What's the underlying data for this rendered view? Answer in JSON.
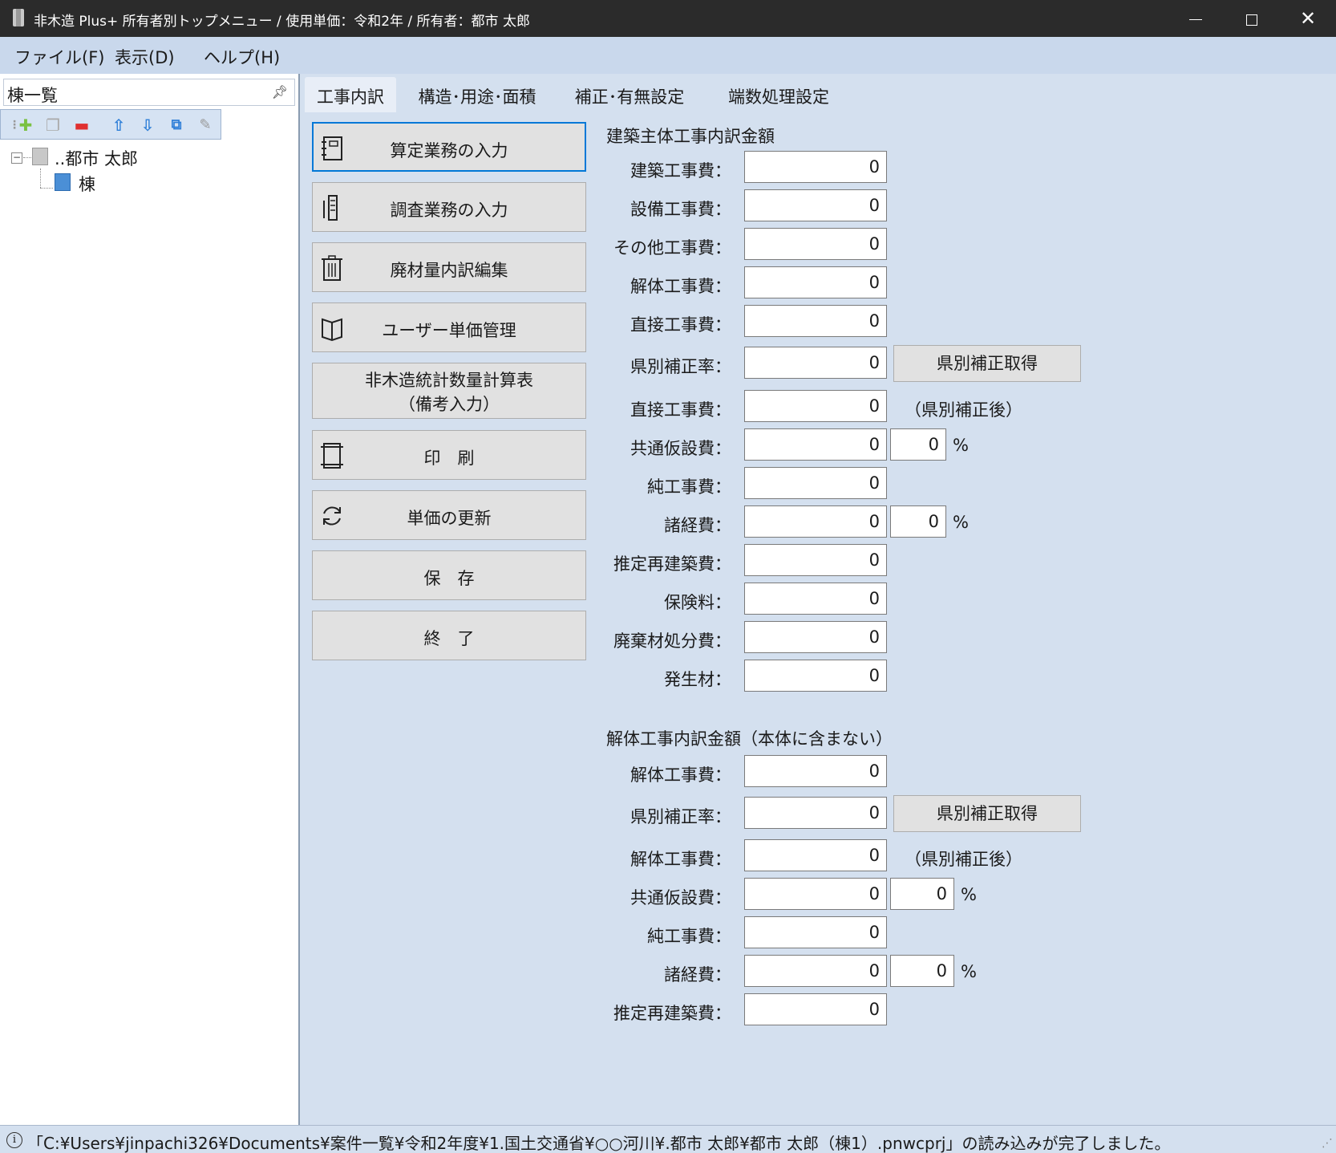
{
  "window": {
    "title": "非木造 Plus+ 所有者別トップメニュー / 使用単価：令和2年 / 所有者：都市 太郎"
  },
  "menu": {
    "file": "ファイル(F)",
    "view": "表示(D)",
    "help": "ヘルプ(H)"
  },
  "left_panel": {
    "title": "棟一覧",
    "tree": {
      "owner": "..都市 太郎",
      "building": "棟"
    }
  },
  "tabs": [
    "工事内訳",
    "構造･用途･面積",
    "補正･有無設定",
    "端数処理設定"
  ],
  "actions": {
    "calc_input": "算定業務の入力",
    "survey_input": "調査業務の入力",
    "waste_edit": "廃材量内訳編集",
    "user_price": "ユーザー単価管理",
    "stats_line1": "非木造統計数量計算表",
    "stats_line2": "（備考入力）",
    "print": "印　刷",
    "update_price": "単価の更新",
    "save": "保　存",
    "exit": "終　了"
  },
  "section1": {
    "title": "建築主体工事内訳金額",
    "rows": [
      {
        "label": "建築工事費：",
        "value": "0"
      },
      {
        "label": "設備工事費：",
        "value": "0"
      },
      {
        "label": "その他工事費：",
        "value": "0"
      },
      {
        "label": "解体工事費：",
        "value": "0"
      },
      {
        "label": "直接工事費：",
        "value": "0"
      },
      {
        "label": "県別補正率：",
        "value": "0"
      },
      {
        "label": "直接工事費：",
        "value": "0"
      },
      {
        "label": "共通仮設費：",
        "value": "0",
        "percent": "0"
      },
      {
        "label": "純工事費：",
        "value": "0"
      },
      {
        "label": "諸経費：",
        "value": "0",
        "percent": "0"
      },
      {
        "label": "推定再建築費：",
        "value": "0"
      },
      {
        "label": "保険料：",
        "value": "0"
      },
      {
        "label": "廃棄材処分費：",
        "value": "0"
      },
      {
        "label": "発生材：",
        "value": "0"
      }
    ],
    "get_correction_button": "県別補正取得",
    "after_correction_note": "（県別補正後）"
  },
  "section2": {
    "title": "解体工事内訳金額（本体に含まない）",
    "rows": [
      {
        "label": "解体工事費：",
        "value": "0"
      },
      {
        "label": "県別補正率：",
        "value": "0"
      },
      {
        "label": "解体工事費：",
        "value": "0"
      },
      {
        "label": "共通仮設費：",
        "value": "0",
        "percent": "0"
      },
      {
        "label": "純工事費：",
        "value": "0"
      },
      {
        "label": "諸経費：",
        "value": "0",
        "percent": "0"
      },
      {
        "label": "推定再建築費：",
        "value": "0"
      }
    ],
    "get_correction_button": "県別補正取得",
    "after_correction_note": "（県別補正後）"
  },
  "percent_sign": "%",
  "status": {
    "message": "「C:¥Users¥jinpachi326¥Documents¥案件一覧¥令和2年度¥1.国土交通省¥○○河川¥.都市 太郎¥都市 太郎（棟1）.pnwcprj」の読み込みが完了しました。"
  }
}
